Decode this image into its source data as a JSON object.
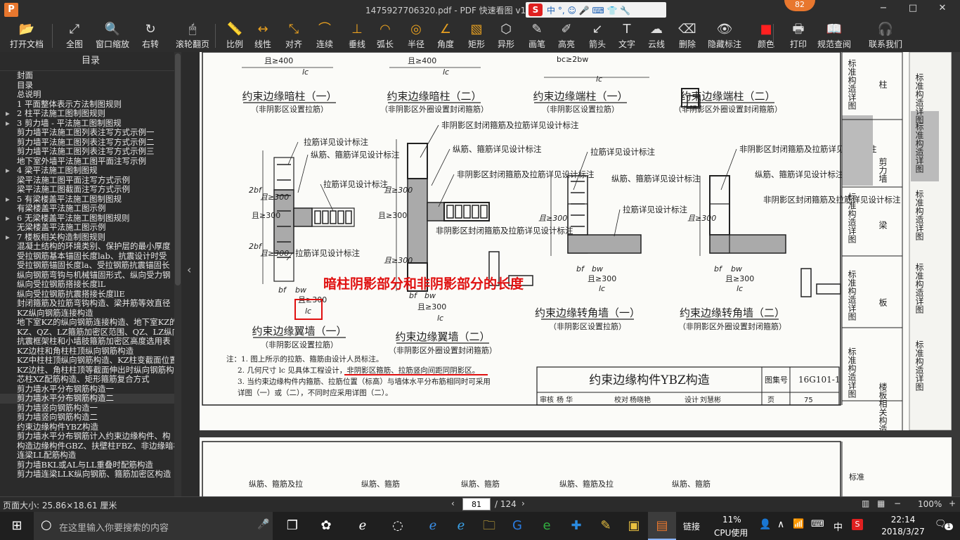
{
  "window": {
    "title": "1475927706320.pdf - PDF 快速看图 v1.9",
    "logo_letter": "P",
    "badge": "82",
    "controls": [
      "−",
      "□",
      "✕"
    ]
  },
  "ime": {
    "brand": "S",
    "text": "中 °, ☺ 🎤 ⌨ 👕 🔧"
  },
  "toolbar": [
    {
      "name": "open-file",
      "label": "打开文档",
      "icon": "📂"
    },
    {
      "name": "full-view",
      "label": "全图",
      "icon": "⤢"
    },
    {
      "name": "window-zoom",
      "label": "窗口缩放",
      "icon": "🔍"
    },
    {
      "name": "rotate-right",
      "label": "右转",
      "icon": "↻"
    },
    {
      "name": "scroll-page",
      "label": "滚轮翻页",
      "icon": "🖱"
    },
    {
      "name": "scale",
      "label": "比例",
      "icon": "📏"
    },
    {
      "name": "linear",
      "label": "线性",
      "icon": "↔"
    },
    {
      "name": "align",
      "label": "对齐",
      "icon": "⤡"
    },
    {
      "name": "continuous",
      "label": "连续",
      "icon": "⌒"
    },
    {
      "name": "perpendicular",
      "label": "垂线",
      "icon": "⊥"
    },
    {
      "name": "arc-length",
      "label": "弧长",
      "icon": "◠"
    },
    {
      "name": "radius",
      "label": "半径",
      "icon": "◎"
    },
    {
      "name": "angle",
      "label": "角度",
      "icon": "∠"
    },
    {
      "name": "rectangle",
      "label": "矩形",
      "icon": "▧"
    },
    {
      "name": "irregular",
      "label": "异形",
      "icon": "⬡"
    },
    {
      "name": "pencil",
      "label": "画笔",
      "icon": "✎"
    },
    {
      "name": "highlighter",
      "label": "高亮",
      "icon": "✐"
    },
    {
      "name": "arrow",
      "label": "箭头",
      "icon": "↙"
    },
    {
      "name": "text",
      "label": "文字",
      "icon": "T"
    },
    {
      "name": "cloud",
      "label": "云线",
      "icon": "☁"
    },
    {
      "name": "delete",
      "label": "删除",
      "icon": "⌫"
    },
    {
      "name": "hide-annotations",
      "label": "隐藏标注",
      "icon": "👁"
    },
    {
      "name": "color",
      "label": "颜色",
      "icon": "■"
    },
    {
      "name": "print",
      "label": "打印",
      "icon": "🖶"
    },
    {
      "name": "code-lookup",
      "label": "规范查阅",
      "icon": "📖"
    },
    {
      "name": "contact",
      "label": "联系我们",
      "icon": "🎧"
    }
  ],
  "sidebar": {
    "header": "目录",
    "items": [
      {
        "text": "封面",
        "level": 0
      },
      {
        "text": "目录",
        "level": 0
      },
      {
        "text": "总说明",
        "level": 0
      },
      {
        "text": "1 平面整体表示方法制图规则",
        "level": 0
      },
      {
        "text": "2 柱平法施工图制图规则",
        "level": 1,
        "arrow": "▸"
      },
      {
        "text": "3 剪力墙 - 平法施工图制图规",
        "level": 1,
        "arrow": "▸"
      },
      {
        "text": "剪力墙平法施工图列表注写方式示例一",
        "level": 0
      },
      {
        "text": "剪力墙平法施工图列表注写方式示例二",
        "level": 0
      },
      {
        "text": "剪力墙平法施工图列表注写方式示例三",
        "level": 0
      },
      {
        "text": "地下室外墙平法施工图平面注写示例",
        "level": 0
      },
      {
        "text": "4 梁平法施工图制图规",
        "level": 1,
        "arrow": "▸"
      },
      {
        "text": "梁平法施工图平面注写方式示例",
        "level": 0
      },
      {
        "text": "梁平法施工图截面注写方式示例",
        "level": 0
      },
      {
        "text": "5 有梁楼盖平法施工图制图规",
        "level": 1,
        "arrow": "▸"
      },
      {
        "text": "有梁楼盖平法施工图示例",
        "level": 0
      },
      {
        "text": "6 无梁楼盖平法施工图制图规则",
        "level": 1,
        "arrow": "▸"
      },
      {
        "text": "无梁楼盖平法施工图示例",
        "level": 0
      },
      {
        "text": "7 楼板相关构造制图规则",
        "level": 1,
        "arrow": "▸"
      },
      {
        "text": "混凝土结构的环境类别、保护层的最小厚度",
        "level": 0
      },
      {
        "text": "受拉钢筋基本锚固长度lab、抗震设计时受",
        "level": 0
      },
      {
        "text": "受拉钢筋锚固长度la、受拉钢筋抗震锚固长",
        "level": 0
      },
      {
        "text": "纵向钢筋弯钩与机械锚固形式、纵向受力钢",
        "level": 0
      },
      {
        "text": "纵向受拉钢筋搭接长度lL",
        "level": 0
      },
      {
        "text": "纵向受拉钢筋抗震搭接长度llE",
        "level": 0
      },
      {
        "text": "封闭箍筋及拉筋弯钩构造、梁并筋等效直径",
        "level": 0
      },
      {
        "text": "KZ纵向钢筋连接构造",
        "level": 0
      },
      {
        "text": "地下室KZ的纵向钢筋连接构造、地下室KZ的",
        "level": 0
      },
      {
        "text": "KZ、QZ、LZ箍筋加密区范围、QZ、LZ纵向钢",
        "level": 0
      },
      {
        "text": "抗震框架柱和小墙肢箍筋加密区高度选用表",
        "level": 0
      },
      {
        "text": "KZ边柱和角柱柱顶纵向钢筋构造",
        "level": 0
      },
      {
        "text": "KZ中柱柱顶纵向钢筋构造、KZ柱变截面位置",
        "level": 0
      },
      {
        "text": "KZ边柱、角柱柱顶等截面伸出时纵向钢筋构",
        "level": 0
      },
      {
        "text": "芯柱XZ配筋构造、矩形箍筋复合方式",
        "level": 0
      },
      {
        "text": "剪力墙水平分布钢筋构造一",
        "level": 0
      },
      {
        "text": "剪力墙水平分布钢筋构造二",
        "level": 0,
        "selected": true
      },
      {
        "text": "剪力墙竖向钢筋构造一",
        "level": 0
      },
      {
        "text": "剪力墙竖向钢筋构造二",
        "level": 0
      },
      {
        "text": "约束边缘构件YBZ构造",
        "level": 0
      },
      {
        "text": "剪力墙水平分布钢筋计入约束边缘构件、构",
        "level": 0
      },
      {
        "text": "构造边缘构件GBZ、扶壁柱FBZ、非边缘暗柱",
        "level": 0
      },
      {
        "text": "连梁LL配筋构造",
        "level": 0
      },
      {
        "text": "剪力墙BKL或AL与LL重叠时配筋构造",
        "level": 0
      },
      {
        "text": "剪力墙连梁LLK纵向钢筋、箍筋加密区构造",
        "level": 0
      }
    ]
  },
  "drawing": {
    "top_labels": [
      "约束边缘暗柱（一）",
      "约束边缘暗柱（二）",
      "约束边缘端柱（一）",
      "约束边缘端柱（二）"
    ],
    "top_sublabels": [
      "（非阴影区设置拉筋）",
      "（非阴影区外圈设置封闭箍筋）",
      "（非阴影区设置拉筋）",
      "（非阴影区外圈设置封闭箍筋）"
    ],
    "bottom_labels": [
      "约束边缘翼墙（一）",
      "约束边缘翼墙（二）",
      "约束边缘转角墙（一）",
      "约束边缘转角墙（二）"
    ],
    "bottom_sublabels": [
      "（非阴影区设置拉筋）",
      "（非阴影区外圈设置封闭箍筋）",
      "（非阴影区设置拉筋）",
      "（非阴影区外圈设置封闭箍筋）"
    ],
    "annotations": [
      "拉筋详见设计标注",
      "纵筋、箍筋详见设计标注",
      "拉筋详见设计标注",
      "非阴影区封闭箍筋及拉筋详见设计标注",
      "纵筋、箍筋详见设计标注",
      "非阴影区封闭箍筋及拉筋详见设计标注",
      "非阴影区封闭箍筋及拉筋详见设计标注",
      "拉筋详见设计标注",
      "纵筋、箍筋详见设计标注",
      "拉筋详见设计标注",
      "非阴影区封闭箍筋及拉筋详见设计标注",
      "纵筋、箍筋详见设计标注",
      "非阴影区封闭箍筋及拉筋详见设计标注",
      "拉筋详见设计标注"
    ],
    "dims": [
      "且≥400",
      "bc≥2bw",
      "lc",
      "且≥300",
      "bf",
      "bw",
      "2bf",
      "bc"
    ],
    "red_annotation": "暗柱阴影部分和非阴影部分的长度",
    "notes": [
      "注：1. 图上所示的拉筋、箍筋由设计人员标注。",
      "2. 几何尺寸 lc 见具体工程设计，非阴影区箍筋、拉筋竖向间距同阴影区。",
      "3. 当约束边缘构件内箍筋、拉筋位置（标高）与墙体水平分布筋相同时可采用",
      "详图（一）或（二），不同时应采用详图（二）。"
    ],
    "title_block": {
      "title": "约束边缘构件YBZ构造",
      "atlas_label": "图集号",
      "atlas_no": "16G101-1",
      "row": [
        "审核",
        "杨 华",
        "校对",
        "杨晓艳",
        "设计",
        "刘慧彬",
        "页",
        "75"
      ]
    },
    "side_tabs": [
      "标准构造详图",
      "柱",
      "标准构造详图",
      "剪力墙",
      "标准构造详图",
      "梁",
      "标准构造详图",
      "板",
      "标准构造详图",
      "楼板相关构造"
    ],
    "next_page_snippets": [
      "纵筋、箍筋及拉",
      "纵筋、箍筋",
      "纵筋、箍筋",
      "纵筋、箍筋及拉",
      "纵筋、箍筋",
      "标准"
    ]
  },
  "status": {
    "page_size": "页面大小: 25.86×18.61 厘米",
    "current_page": "81",
    "total_pages": "/ 124",
    "zoom": "100%"
  },
  "taskbar": {
    "search_placeholder": "在这里输入你要搜索的内容",
    "tray_link": "链接",
    "cpu_percent": "11%",
    "cpu_label": "CPU使用",
    "lang": "中",
    "time": "22:14",
    "date": "2018/3/27",
    "notify": "1"
  },
  "colors": {
    "toolbar_bg": "#2d2d2d",
    "accent": "#e8772e",
    "red_annotation": "#e01010",
    "taskbar_bg": "#1f1f1f"
  }
}
